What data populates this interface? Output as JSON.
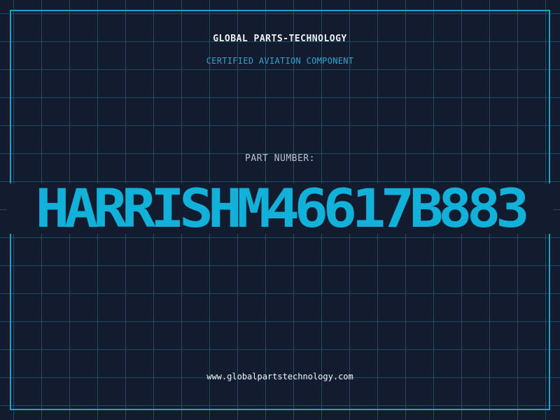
{
  "header": {
    "company": "GLOBAL PARTS-TECHNOLOGY",
    "subtitle": "CERTIFIED AVIATION COMPONENT"
  },
  "part": {
    "label": "PART NUMBER:",
    "number": "HARRISHM46617B883"
  },
  "footer": {
    "website": "www.globalpartstechnology.com"
  },
  "colors": {
    "background": "#131b2e",
    "grid": "#1f4d63",
    "frame": "#1aa3c8",
    "accent": "#10b2d9",
    "subtitle": "#2aa6d0"
  }
}
